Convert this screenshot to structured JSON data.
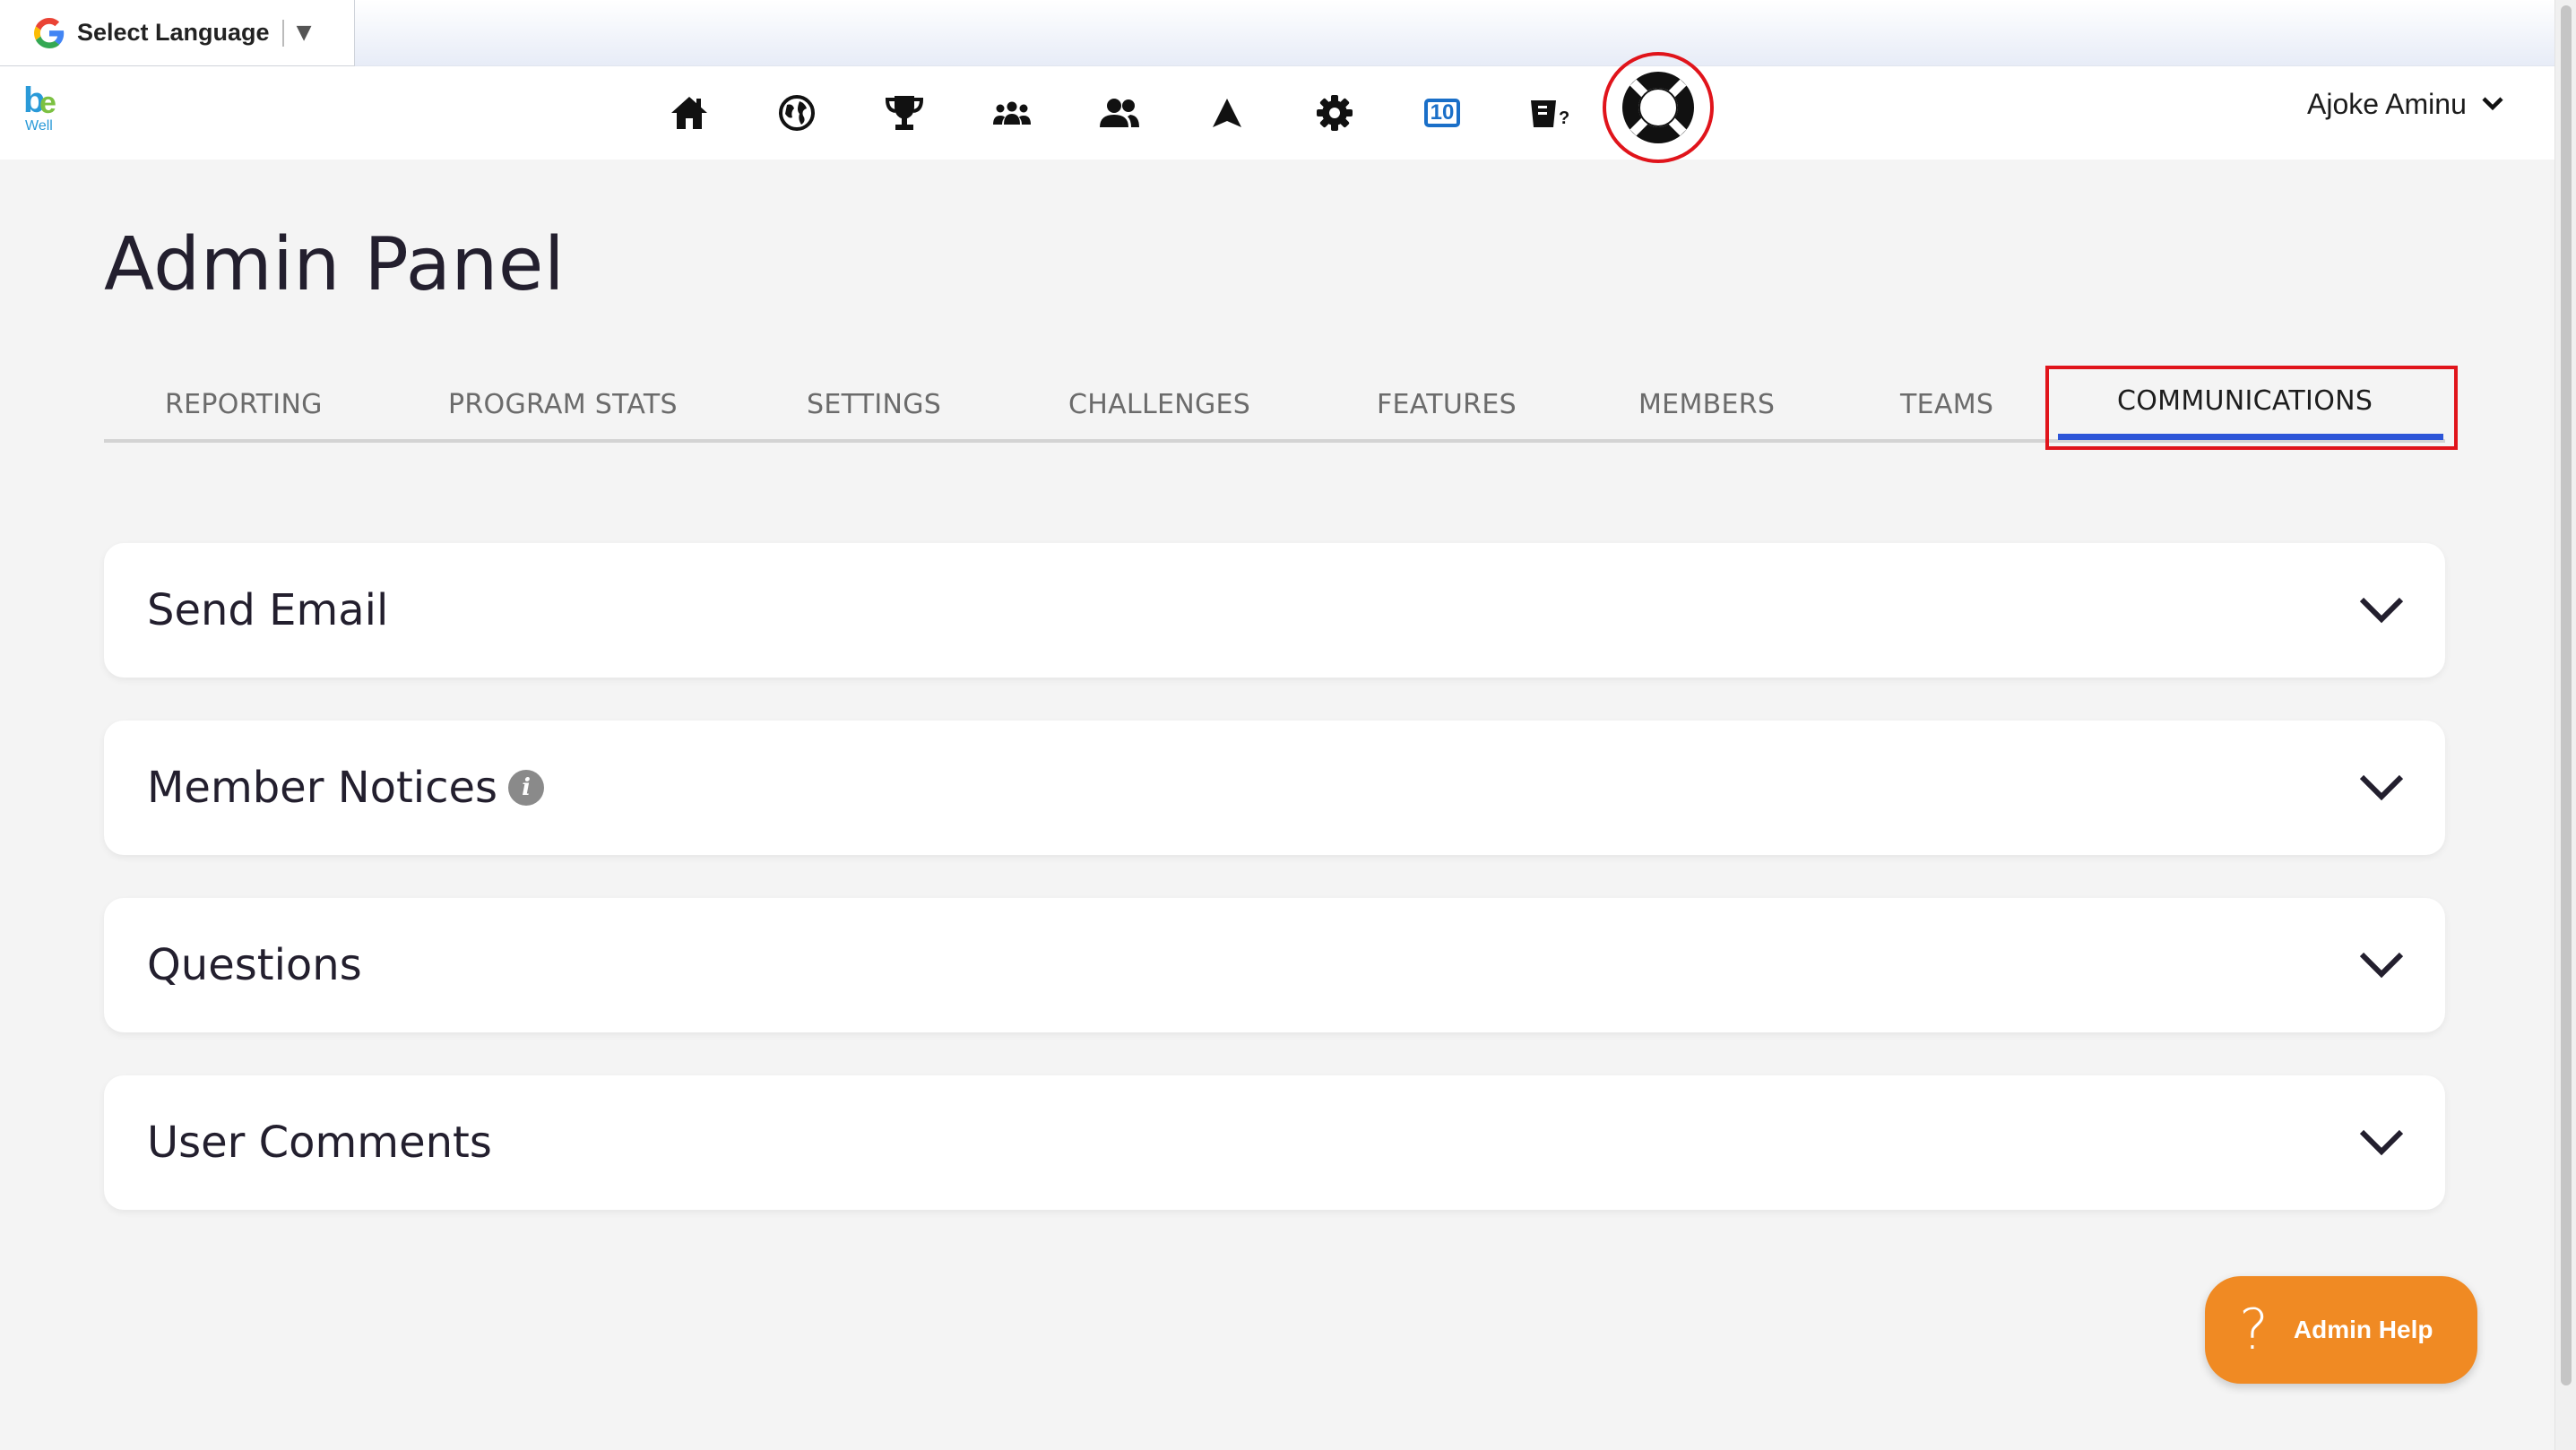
{
  "translate_bar": {
    "label": "Select Language",
    "arrow": "▼"
  },
  "brand": {
    "logo_b": "b",
    "logo_e": "e",
    "logo_sub": "Well"
  },
  "nav": {
    "icons": [
      "home-icon",
      "globe-icon",
      "trophy-icon",
      "group-icon",
      "users-icon",
      "navigation-arrow-icon",
      "gear-icon",
      "ten-badge-icon",
      "quiz-icon",
      "lifebuoy-help-icon"
    ],
    "badge_value": "10"
  },
  "user": {
    "name": "Ajoke Aminu"
  },
  "page": {
    "title": "Admin Panel"
  },
  "tabs": [
    {
      "label": "REPORTING"
    },
    {
      "label": "PROGRAM STATS"
    },
    {
      "label": "SETTINGS"
    },
    {
      "label": "CHALLENGES"
    },
    {
      "label": "FEATURES"
    },
    {
      "label": "MEMBERS"
    },
    {
      "label": "TEAMS"
    },
    {
      "label": "COMMUNICATIONS",
      "active": true
    }
  ],
  "sections": [
    {
      "title": "Send Email"
    },
    {
      "title": "Member Notices",
      "info": "i"
    },
    {
      "title": "Questions"
    },
    {
      "title": "User Comments"
    }
  ],
  "admin_help": {
    "icon": "?",
    "label": "Admin Help"
  },
  "colors": {
    "accent_tab": "#2d55d8",
    "highlight": "#e0141b",
    "help_button": "#f08a23",
    "page_bg": "#f4f4f4"
  }
}
